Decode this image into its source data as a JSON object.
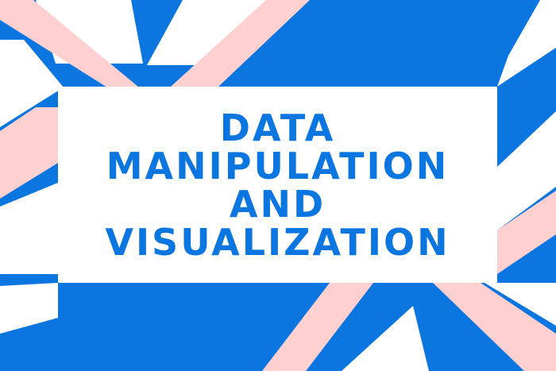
{
  "title": {
    "lines": [
      "DATA",
      "MANIPULATION",
      "AND",
      "VISUALIZATION"
    ]
  },
  "colors": {
    "background": "#0b76e0",
    "stripe_pink": "#ffd0d0",
    "card": "#ffffff",
    "title_text": "#0b76e0"
  }
}
